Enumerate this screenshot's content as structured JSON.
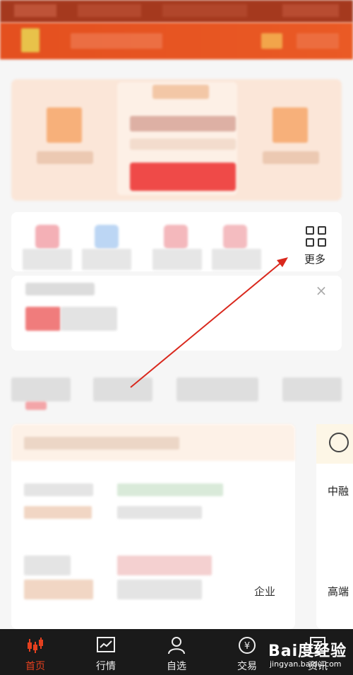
{
  "shortcuts": {
    "more_label": "更多"
  },
  "side_card": {
    "title_fragment": "中融",
    "subtitle_fragment": "高端"
  },
  "content_card": {
    "text_fragment": "企业"
  },
  "bottom_nav": {
    "items": [
      {
        "label": "首页",
        "icon": "candlestick-icon",
        "active": true
      },
      {
        "label": "行情",
        "icon": "line-chart-icon",
        "active": false
      },
      {
        "label": "自选",
        "icon": "user-icon",
        "active": false
      },
      {
        "label": "交易",
        "icon": "yen-coin-icon",
        "active": false
      },
      {
        "label": "资讯",
        "icon": "news-icon",
        "active": false
      }
    ]
  },
  "watermark": {
    "brand": "Bai度经验",
    "site": "jingyan.baidu.com"
  },
  "colors": {
    "header": "#e4501f",
    "accent": "#e4401f",
    "annotation_arrow": "#d9281d",
    "nav_background": "#1a1a1a"
  }
}
